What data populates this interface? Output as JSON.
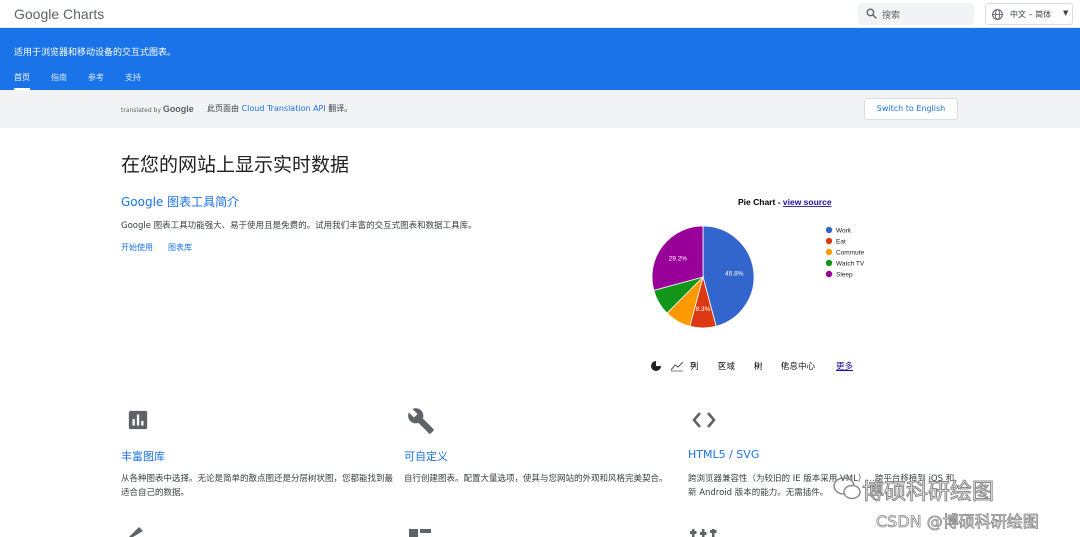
{
  "header": {
    "logo": "Google Charts",
    "search_placeholder": "搜索",
    "language": "中文 – 简体"
  },
  "banner": {
    "subtitle": "适用于浏览器和移动设备的交互式图表。",
    "tabs": [
      "首页",
      "指南",
      "参考",
      "支持"
    ]
  },
  "translation": {
    "translated_by": "translated by",
    "google": "Google",
    "note_prefix": "此页面由",
    "note_link": "Cloud Translation API",
    "note_suffix": "翻译。",
    "switch_button": "Switch to English"
  },
  "main": {
    "title": "在您的网站上显示实时数据",
    "section_title": "Google 图表工具简介",
    "intro": "Google 图表工具功能强大、易于使用且是免费的。试用我们丰富的交互式图表和数据工具库。",
    "links": [
      "开始使用",
      "图表库"
    ]
  },
  "chart_data": {
    "type": "pie",
    "title": "Pie Chart",
    "title_sep": " - ",
    "title_link": "view source",
    "categories": [
      "Work",
      "Eat",
      "Commute",
      "Watch TV",
      "Sleep"
    ],
    "values": [
      45.8,
      8.3,
      8.3,
      8.3,
      29.2
    ],
    "labels": [
      "45.8%",
      "8.3%",
      "",
      "",
      "29.2%"
    ],
    "colors": [
      "#3366cc",
      "#dc3912",
      "#ff9900",
      "#109618",
      "#990099"
    ],
    "legend_position": "right"
  },
  "chart_thumbs": {
    "items": [
      "列",
      "区域",
      "树",
      "信息中心"
    ],
    "more": "更多"
  },
  "features": [
    {
      "title": "丰富图库",
      "desc": "从各种图表中选择。无论是简单的散点图还是分层树状图，您都能找到最适合自己的数据。"
    },
    {
      "title": "可自定义",
      "desc": "自行创建图表。配置大量选项，使其与您网站的外观和风格完美契合。"
    },
    {
      "title": "HTML5 / SVG",
      "desc": "跨浏览器兼容性（为较旧的 IE 版本采用 VML）…跨平台移植到 iOS 和新 Android 版本的能力。无需插件。"
    }
  ],
  "watermark": {
    "line1": "博硕科研绘图",
    "line2": "CSDN @博硕科研绘图"
  }
}
